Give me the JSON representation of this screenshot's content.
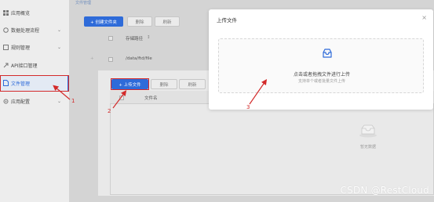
{
  "breadcrumb": "文件管理",
  "sidebar": {
    "items": [
      {
        "label": "应用概览",
        "icon": "grid-icon",
        "chevron": ""
      },
      {
        "label": "数据处理流程",
        "icon": "flow-icon",
        "chevron": "⌄"
      },
      {
        "label": "规则管理",
        "icon": "rule-icon",
        "chevron": "⌄"
      },
      {
        "label": "API接口管理",
        "icon": "api-icon",
        "chevron": ""
      },
      {
        "label": "文件管理",
        "icon": "file-icon",
        "chevron": ""
      },
      {
        "label": "应用配置",
        "icon": "gear-icon",
        "chevron": "⌄"
      }
    ]
  },
  "toolbar_top": {
    "create_folder": "+ 创建文件夹",
    "delete": "删除",
    "refresh": "刷新"
  },
  "table_top": {
    "header": "存储路径",
    "sort_icon": "↕",
    "row_path": "/data/ftd/file"
  },
  "toolbar_inner": {
    "upload": "+ 上传文件",
    "delete": "删除",
    "refresh": "刷新"
  },
  "table_inner": {
    "header": "文件名",
    "empty_text": "暂无数据"
  },
  "modal": {
    "title": "上传文件",
    "close": "×",
    "drop_main": "点击或者拖拽文件进行上传",
    "drop_sub": "支持单个或者批量文件上传"
  },
  "annotations": {
    "step1": "1",
    "step2": "2",
    "step3": "3"
  },
  "watermark": "CSDN @RestCloud",
  "colors": {
    "primary": "#2e6bd9",
    "annotation": "#d32a2a"
  }
}
